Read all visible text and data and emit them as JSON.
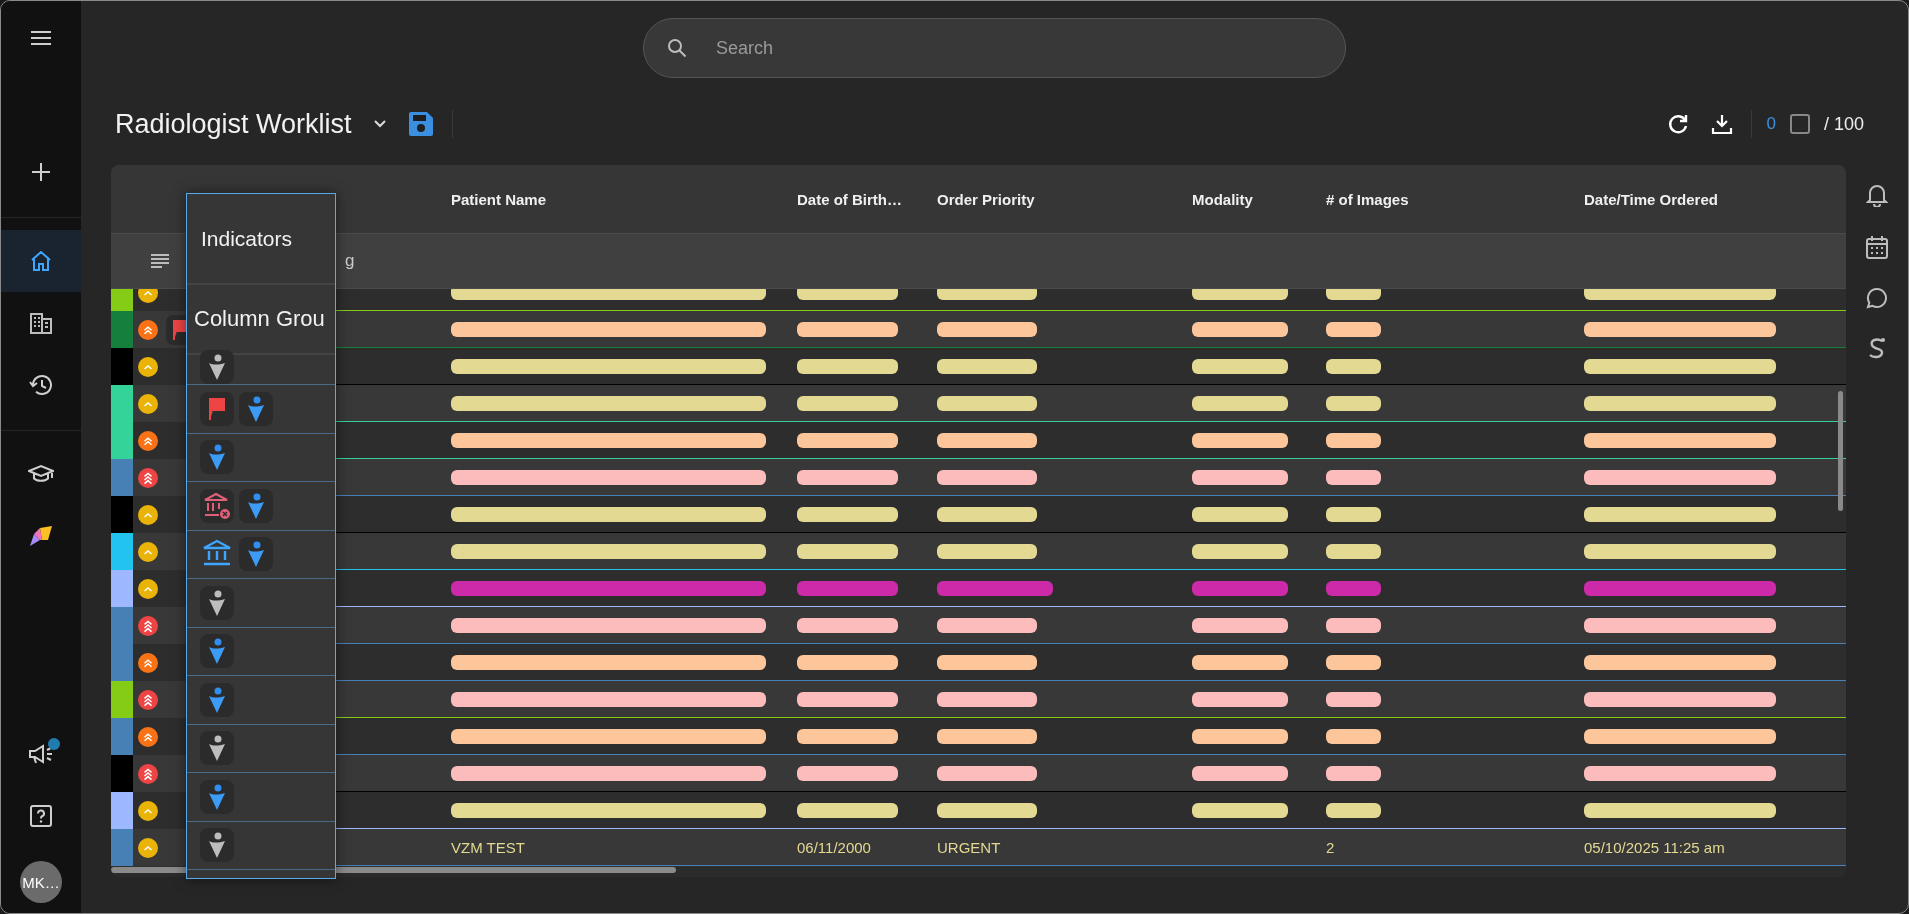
{
  "sidebar": {
    "groups": [
      [
        {
          "kind": "menu",
          "selected": false
        },
        {
          "kind": "add",
          "selected": false
        }
      ],
      [
        {
          "kind": "home",
          "selected": true
        },
        {
          "kind": "building",
          "selected": false
        },
        {
          "kind": "history",
          "selected": false
        }
      ],
      [
        {
          "kind": "school",
          "selected": false
        },
        {
          "kind": "logo",
          "selected": false
        }
      ]
    ],
    "bottom_items": [
      {
        "kind": "megaphone",
        "selected": false,
        "badge": true
      },
      {
        "kind": "help",
        "selected": false,
        "badge": false
      }
    ],
    "avatar": "MK…"
  },
  "search": {
    "placeholder": "Search"
  },
  "header": {
    "title": "Radiologist Worklist",
    "selected_count": "0",
    "select_all_checked": false,
    "total": "/ 100"
  },
  "table": {
    "columns": [
      "Patient Name",
      "Date of Birth…",
      "Order Priority",
      "Modality",
      "# of Images",
      "Date/Time Ordered"
    ],
    "group_panel_text": "g",
    "rows": [
      {
        "kind": "redacted",
        "color": "#84cc16",
        "priority": {
          "kind": "single"
        },
        "redaction": {
          "color": "#e3d993"
        },
        "flag": false
      },
      {
        "kind": "redacted",
        "color": "#15803d",
        "priority": {
          "kind": "double"
        },
        "redaction": {
          "color": "#fdc59a"
        },
        "flag": true
      },
      {
        "kind": "redacted",
        "color": "#000000",
        "priority": {
          "kind": "single"
        },
        "redaction": {
          "color": "#e3d993"
        },
        "flag": false
      },
      {
        "kind": "redacted",
        "color": "#34d399",
        "priority": {
          "kind": "single"
        },
        "redaction": {
          "color": "#e3d993"
        },
        "flag": false
      },
      {
        "kind": "redacted",
        "color": "#34d399",
        "priority": {
          "kind": "double"
        },
        "redaction": {
          "color": "#fdc59a"
        },
        "flag": false
      },
      {
        "kind": "redacted",
        "color": "#4680b4",
        "priority": {
          "kind": "triple"
        },
        "redaction": {
          "color": "#fdbcbc"
        },
        "flag": false
      },
      {
        "kind": "redacted",
        "color": "#000000",
        "priority": {
          "kind": "single"
        },
        "redaction": {
          "color": "#e3d993"
        },
        "flag": false
      },
      {
        "kind": "redacted",
        "color": "#22c3ee",
        "priority": {
          "kind": "single"
        },
        "redaction": {
          "color": "#e3d993"
        },
        "flag": false
      },
      {
        "kind": "redacted",
        "color": "#9db8ff",
        "priority": {
          "kind": "single"
        },
        "redaction": {
          "color": "#cc2aa8"
        },
        "flag": false
      },
      {
        "kind": "redacted",
        "color": "#4680b4",
        "priority": {
          "kind": "triple"
        },
        "redaction": {
          "color": "#fdbcbc"
        },
        "flag": false
      },
      {
        "kind": "redacted",
        "color": "#4680b4",
        "priority": {
          "kind": "double"
        },
        "redaction": {
          "color": "#fdc59a"
        },
        "flag": false
      },
      {
        "kind": "redacted",
        "color": "#84cc16",
        "priority": {
          "kind": "triple"
        },
        "redaction": {
          "color": "#fdbcbc"
        },
        "flag": false
      },
      {
        "kind": "redacted",
        "color": "#4680b4",
        "priority": {
          "kind": "double"
        },
        "redaction": {
          "color": "#fdc59a"
        },
        "flag": false
      },
      {
        "kind": "redacted",
        "color": "#000000",
        "priority": {
          "kind": "triple"
        },
        "redaction": {
          "color": "#fdbcbc"
        },
        "flag": false
      },
      {
        "kind": "redacted",
        "color": "#9db8ff",
        "priority": {
          "kind": "single"
        },
        "redaction": {
          "color": "#e3d993"
        },
        "flag": false
      },
      {
        "kind": "text",
        "color": "#4680b4",
        "priority": {
          "kind": "single"
        },
        "flag": false,
        "cells": {
          "patient_name": "VZM TEST",
          "date_of_birth": "06/11/2000",
          "order_priority": "URGENT",
          "images": "2",
          "date_time_ordered": "05/10/2025 11:25 am"
        }
      }
    ]
  },
  "drag_ghost": {
    "header": "Indicators",
    "subheader": "Column Grou",
    "rows": [
      {
        "icons": [
          {
            "kind": "patient-grey"
          }
        ]
      },
      {
        "icons": [
          {
            "kind": "flag"
          },
          {
            "kind": "patient-blue"
          }
        ]
      },
      {
        "icons": [
          {
            "kind": "patient-blue"
          }
        ]
      },
      {
        "icons": [
          {
            "kind": "bank-cancel"
          },
          {
            "kind": "patient-blue"
          }
        ]
      },
      {
        "icons": [
          {
            "kind": "bank"
          },
          {
            "kind": "patient-blue"
          }
        ]
      },
      {
        "icons": [
          {
            "kind": "patient-grey"
          }
        ]
      },
      {
        "icons": [
          {
            "kind": "patient-blue"
          }
        ]
      },
      {
        "icons": [
          {
            "kind": "patient-blue"
          }
        ]
      },
      {
        "icons": [
          {
            "kind": "patient-grey"
          }
        ]
      },
      {
        "icons": [
          {
            "kind": "patient-blue"
          }
        ]
      },
      {
        "icons": [
          {
            "kind": "patient-grey"
          }
        ]
      }
    ]
  },
  "right_rail": {
    "items": [
      {
        "kind": "bell"
      },
      {
        "kind": "calendar"
      },
      {
        "kind": "chat"
      },
      {
        "kind": "s-logo"
      }
    ]
  }
}
